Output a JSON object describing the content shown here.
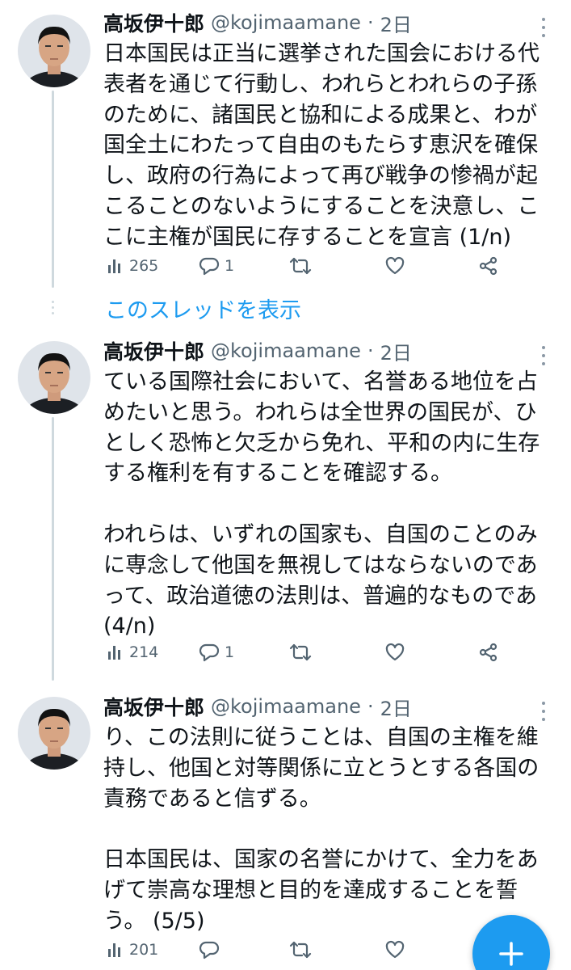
{
  "tweets": [
    {
      "author": "高坂伊十郎",
      "handle": "@kojimaamane",
      "separator": "·",
      "time": "2日",
      "lines": [
        "日本国民は正当に選挙された国会における代",
        "表者を通じて行動し、われらとわれらの子孫",
        "のために、諸国民と協和による成果と、わが",
        "国全土にわたって自由のもたらす恵沢を確保",
        "し、政府の行為によって再び戦争の惨禍が起",
        "こることのないようにすることを決意し、こ",
        "こに主権が国民に存することを宣言 (1/n)"
      ],
      "views": "265",
      "replies": "1",
      "retweets": "",
      "likes": ""
    },
    {
      "author": "高坂伊十郎",
      "handle": "@kojimaamane",
      "separator": "·",
      "time": "2日",
      "lines": [
        "ている国際社会において、名誉ある地位を占",
        "めたいと思う。われらは全世界の国民が、ひ",
        "としく恐怖と欠乏から免れ、平和の内に生存",
        "する権利を有することを確認する。",
        "",
        "われらは、いずれの国家も、自国のことのみ",
        "に専念して他国を無視してはならないのであ",
        "って、政治道徳の法則は、普遍的なものであ",
        "(4/n)"
      ],
      "views": "214",
      "replies": "1",
      "retweets": "",
      "likes": ""
    },
    {
      "author": "高坂伊十郎",
      "handle": "@kojimaamane",
      "separator": "·",
      "time": "2日",
      "lines": [
        "り、この法則に従うことは、自国の主権を維",
        "持し、他国と対等関係に立とうとする各国の",
        "責務であると信ずる。",
        "",
        "日本国民は、国家の名誉にかけて、全力をあ",
        "げて崇高な理想と目的を達成することを誓",
        "う。 (5/5)"
      ],
      "views": "201",
      "replies": "",
      "retweets": "",
      "likes": ""
    }
  ],
  "show_thread_link": "このスレッドを表示",
  "fab": {
    "label": "+",
    "icon": "plus-icon"
  },
  "icons": {
    "views": "views-chart-icon",
    "reply": "reply-bubble-icon",
    "retweet": "retweet-icon",
    "like": "heart-icon",
    "share": "share-icon",
    "more": "more-vertical-icon"
  },
  "colors": {
    "accent": "#1d9bf0",
    "text": "#0f1419",
    "secondary": "#536471",
    "thread_line": "#cfd9de"
  }
}
